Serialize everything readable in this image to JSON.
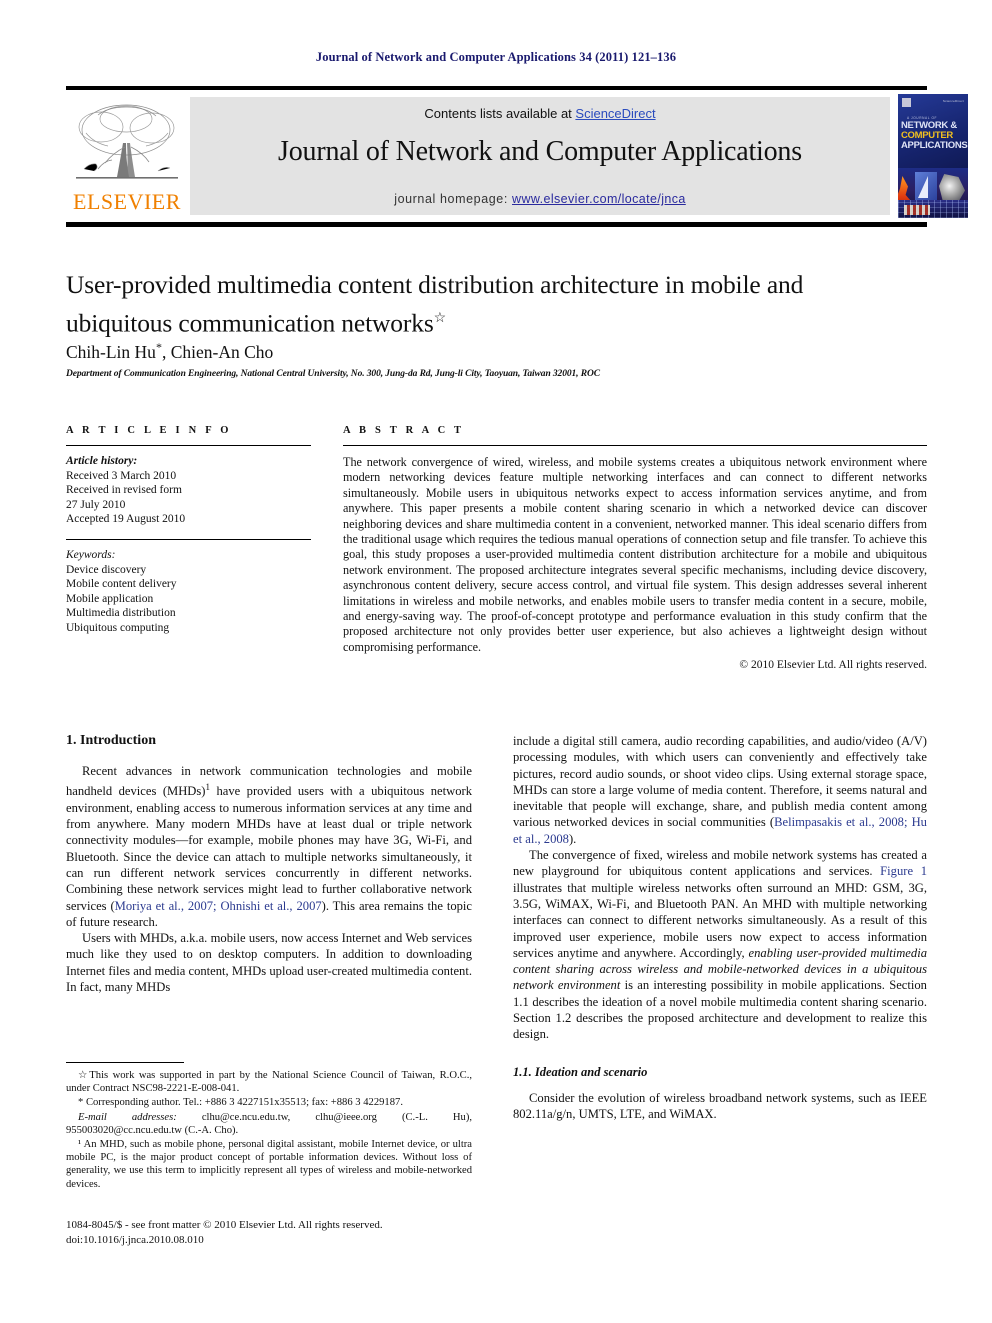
{
  "running_head": "Journal of Network and Computer Applications 34 (2011) 121–136",
  "header": {
    "contents_prefix": "Contents lists available at ",
    "sciencedirect": "ScienceDirect",
    "journal_title": "Journal of Network and Computer Applications",
    "homepage_prefix": "journal homepage: ",
    "homepage_url": "www.elsevier.com/locate/jnca",
    "publisher_logo_text": "ELSEVIER",
    "cover": {
      "kicker": "A JOURNAL OF",
      "line1": "NETWORK &",
      "line2": "COMPUTER",
      "line3": "APPLICATIONS",
      "corner_text": "ScienceDirect"
    },
    "accent_link_color": "#2a4bbd"
  },
  "article": {
    "title": "User-provided multimedia content distribution architecture in mobile and ubiquitous communication networks",
    "title_footnote_mark": "☆",
    "authors": "Chih-Lin Hu",
    "authors_mark": "*",
    "authors_rest": ", Chien-An Cho",
    "affiliation": "Department of Communication Engineering, National Central University, No. 300, Jung-da Rd, Jung-li City, Taoyuan, Taiwan 32001, ROC"
  },
  "article_info": {
    "label": "A R T I C L E   I N F O",
    "history_label": "Article history:",
    "history_lines": [
      "Received 3 March 2010",
      "Received in revised form",
      "27 July 2010",
      "Accepted 19 August 2010"
    ],
    "keywords_label": "Keywords:",
    "keywords": [
      "Device discovery",
      "Mobile content delivery",
      "Mobile application",
      "Multimedia distribution",
      "Ubiquitous computing"
    ]
  },
  "abstract": {
    "label": "A B S T R A C T",
    "text": "The network convergence of wired, wireless, and mobile systems creates a ubiquitous network environment where modern networking devices feature multiple networking interfaces and can connect to different networks simultaneously. Mobile users in ubiquitous networks expect to access information services anytime, and from anywhere. This paper presents a mobile content sharing scenario in which a networked device can discover neighboring devices and share multimedia content in a convenient, networked manner. This ideal scenario differs from the traditional usage which requires the tedious manual operations of connection setup and file transfer. To achieve this goal, this study proposes a user-provided multimedia content distribution architecture for a mobile and ubiquitous network environment. The proposed architecture integrates several specific mechanisms, including device discovery, asynchronous content delivery, secure access control, and virtual file system. This design addresses several inherent limitations in wireless and mobile networks, and enables mobile users to transfer media content in a secure, mobile, and energy-saving way. The proof-of-concept prototype and performance evaluation in this study confirm that the proposed architecture not only provides better user experience, but also achieves a lightweight design without compromising performance.",
    "copyright": "© 2010 Elsevier Ltd. All rights reserved."
  },
  "body": {
    "section1_heading": "1.  Introduction",
    "left_paras": [
      "Recent advances in network communication technologies and mobile handheld devices (MHDs)¹ have provided users with a ubiquitous network environment, enabling access to numerous information services at any time and from anywhere. Many modern MHDs have at least dual or triple network connectivity modules—for example, mobile phones may have 3G, Wi-Fi, and Bluetooth. Since the device can attach to multiple networks simultaneously, it can run different network services concurrently in different networks. Combining these network services might lead to further collaborative network services (Moriya et al., 2007; Ohnishi et al., 2007). This area remains the topic of future research.",
      "Users with MHDs, a.k.a. mobile users, now access Internet and Web services much like they used to on desktop computers. In addition to downloading Internet files and media content, MHDs upload user-created multimedia content. In fact, many MHDs"
    ],
    "left_citations": [
      "Moriya et al., 2007;",
      "Ohnishi et al., 2007"
    ],
    "right_paras": [
      "include a digital still camera, audio recording capabilities, and audio/video (A/V) processing modules, with which users can conveniently and effectively take pictures, record audio sounds, or shoot video clips. Using external storage space, MHDs can store a large volume of media content. Therefore, it seems natural and inevitable that people will exchange, share, and publish media content among various networked devices in social communities (Belimpasakis et al., 2008; Hu et al., 2008).",
      "The convergence of fixed, wireless and mobile network systems has created a new playground for ubiquitous content applications and services. Figure 1 illustrates that multiple wireless networks often surround an MHD: GSM, 3G, 3.5G, WiMAX, Wi-Fi, and Bluetooth PAN. An MHD with multiple networking interfaces can connect to different networks simultaneously. As a result of this improved user experience, mobile users now expect to access information services anytime and anywhere. Accordingly, enabling user-provided multimedia content sharing across wireless and mobile-networked devices in a ubiquitous network environment is an interesting possibility in mobile applications. Section 1.1 describes the ideation of a novel mobile multimedia content sharing scenario. Section 1.2 describes the proposed architecture and development to realize this design."
    ],
    "right_citations": [
      "Belimpasakis et al., 2008; Hu et al., 2008",
      "Figure 1"
    ],
    "subsection_heading": "1.1.  Ideation and scenario",
    "right_last_para": "Consider the evolution of wireless broadband network systems, such as IEEE 802.11a/g/n, UMTS, LTE, and WiMAX."
  },
  "footnotes": {
    "items": [
      "☆This work was supported in part by the National Science Council of Taiwan, R.O.C., under Contract NSC98-2221-E-008-041.",
      "* Corresponding author. Tel.: +886 3 4227151x35513; fax: +886 3 4229187.",
      "E-mail addresses: clhu@ce.ncu.edu.tw, clhu@ieee.org (C.-L. Hu), 955003020@cc.ncu.edu.tw (C.-A. Cho).",
      "¹ An MHD, such as mobile phone, personal digital assistant, mobile Internet device, or ultra mobile PC, is the major product concept of portable information devices. Without loss of generality, we use this term to implicitly represent all types of wireless and mobile-networked devices."
    ],
    "email_label": "E-mail addresses:"
  },
  "issn_block": {
    "line1": "1084-8045/$ - see front matter © 2010 Elsevier Ltd. All rights reserved.",
    "line2": "doi:10.1016/j.jnca.2010.08.010"
  }
}
